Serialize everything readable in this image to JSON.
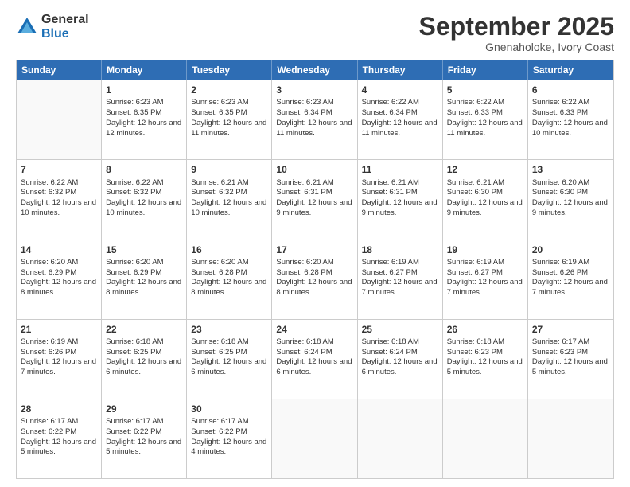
{
  "logo": {
    "general": "General",
    "blue": "Blue"
  },
  "header": {
    "month": "September 2025",
    "location": "Gnenaholoke, Ivory Coast"
  },
  "days": [
    "Sunday",
    "Monday",
    "Tuesday",
    "Wednesday",
    "Thursday",
    "Friday",
    "Saturday"
  ],
  "rows": [
    [
      {
        "day": "",
        "empty": true
      },
      {
        "day": "1",
        "sunrise": "Sunrise: 6:23 AM",
        "sunset": "Sunset: 6:35 PM",
        "daylight": "Daylight: 12 hours and 12 minutes."
      },
      {
        "day": "2",
        "sunrise": "Sunrise: 6:23 AM",
        "sunset": "Sunset: 6:35 PM",
        "daylight": "Daylight: 12 hours and 11 minutes."
      },
      {
        "day": "3",
        "sunrise": "Sunrise: 6:23 AM",
        "sunset": "Sunset: 6:34 PM",
        "daylight": "Daylight: 12 hours and 11 minutes."
      },
      {
        "day": "4",
        "sunrise": "Sunrise: 6:22 AM",
        "sunset": "Sunset: 6:34 PM",
        "daylight": "Daylight: 12 hours and 11 minutes."
      },
      {
        "day": "5",
        "sunrise": "Sunrise: 6:22 AM",
        "sunset": "Sunset: 6:33 PM",
        "daylight": "Daylight: 12 hours and 11 minutes."
      },
      {
        "day": "6",
        "sunrise": "Sunrise: 6:22 AM",
        "sunset": "Sunset: 6:33 PM",
        "daylight": "Daylight: 12 hours and 10 minutes."
      }
    ],
    [
      {
        "day": "7",
        "sunrise": "Sunrise: 6:22 AM",
        "sunset": "Sunset: 6:32 PM",
        "daylight": "Daylight: 12 hours and 10 minutes."
      },
      {
        "day": "8",
        "sunrise": "Sunrise: 6:22 AM",
        "sunset": "Sunset: 6:32 PM",
        "daylight": "Daylight: 12 hours and 10 minutes."
      },
      {
        "day": "9",
        "sunrise": "Sunrise: 6:21 AM",
        "sunset": "Sunset: 6:32 PM",
        "daylight": "Daylight: 12 hours and 10 minutes."
      },
      {
        "day": "10",
        "sunrise": "Sunrise: 6:21 AM",
        "sunset": "Sunset: 6:31 PM",
        "daylight": "Daylight: 12 hours and 9 minutes."
      },
      {
        "day": "11",
        "sunrise": "Sunrise: 6:21 AM",
        "sunset": "Sunset: 6:31 PM",
        "daylight": "Daylight: 12 hours and 9 minutes."
      },
      {
        "day": "12",
        "sunrise": "Sunrise: 6:21 AM",
        "sunset": "Sunset: 6:30 PM",
        "daylight": "Daylight: 12 hours and 9 minutes."
      },
      {
        "day": "13",
        "sunrise": "Sunrise: 6:20 AM",
        "sunset": "Sunset: 6:30 PM",
        "daylight": "Daylight: 12 hours and 9 minutes."
      }
    ],
    [
      {
        "day": "14",
        "sunrise": "Sunrise: 6:20 AM",
        "sunset": "Sunset: 6:29 PM",
        "daylight": "Daylight: 12 hours and 8 minutes."
      },
      {
        "day": "15",
        "sunrise": "Sunrise: 6:20 AM",
        "sunset": "Sunset: 6:29 PM",
        "daylight": "Daylight: 12 hours and 8 minutes."
      },
      {
        "day": "16",
        "sunrise": "Sunrise: 6:20 AM",
        "sunset": "Sunset: 6:28 PM",
        "daylight": "Daylight: 12 hours and 8 minutes."
      },
      {
        "day": "17",
        "sunrise": "Sunrise: 6:20 AM",
        "sunset": "Sunset: 6:28 PM",
        "daylight": "Daylight: 12 hours and 8 minutes."
      },
      {
        "day": "18",
        "sunrise": "Sunrise: 6:19 AM",
        "sunset": "Sunset: 6:27 PM",
        "daylight": "Daylight: 12 hours and 7 minutes."
      },
      {
        "day": "19",
        "sunrise": "Sunrise: 6:19 AM",
        "sunset": "Sunset: 6:27 PM",
        "daylight": "Daylight: 12 hours and 7 minutes."
      },
      {
        "day": "20",
        "sunrise": "Sunrise: 6:19 AM",
        "sunset": "Sunset: 6:26 PM",
        "daylight": "Daylight: 12 hours and 7 minutes."
      }
    ],
    [
      {
        "day": "21",
        "sunrise": "Sunrise: 6:19 AM",
        "sunset": "Sunset: 6:26 PM",
        "daylight": "Daylight: 12 hours and 7 minutes."
      },
      {
        "day": "22",
        "sunrise": "Sunrise: 6:18 AM",
        "sunset": "Sunset: 6:25 PM",
        "daylight": "Daylight: 12 hours and 6 minutes."
      },
      {
        "day": "23",
        "sunrise": "Sunrise: 6:18 AM",
        "sunset": "Sunset: 6:25 PM",
        "daylight": "Daylight: 12 hours and 6 minutes."
      },
      {
        "day": "24",
        "sunrise": "Sunrise: 6:18 AM",
        "sunset": "Sunset: 6:24 PM",
        "daylight": "Daylight: 12 hours and 6 minutes."
      },
      {
        "day": "25",
        "sunrise": "Sunrise: 6:18 AM",
        "sunset": "Sunset: 6:24 PM",
        "daylight": "Daylight: 12 hours and 6 minutes."
      },
      {
        "day": "26",
        "sunrise": "Sunrise: 6:18 AM",
        "sunset": "Sunset: 6:23 PM",
        "daylight": "Daylight: 12 hours and 5 minutes."
      },
      {
        "day": "27",
        "sunrise": "Sunrise: 6:17 AM",
        "sunset": "Sunset: 6:23 PM",
        "daylight": "Daylight: 12 hours and 5 minutes."
      }
    ],
    [
      {
        "day": "28",
        "sunrise": "Sunrise: 6:17 AM",
        "sunset": "Sunset: 6:22 PM",
        "daylight": "Daylight: 12 hours and 5 minutes."
      },
      {
        "day": "29",
        "sunrise": "Sunrise: 6:17 AM",
        "sunset": "Sunset: 6:22 PM",
        "daylight": "Daylight: 12 hours and 5 minutes."
      },
      {
        "day": "30",
        "sunrise": "Sunrise: 6:17 AM",
        "sunset": "Sunset: 6:22 PM",
        "daylight": "Daylight: 12 hours and 4 minutes."
      },
      {
        "day": "",
        "empty": true
      },
      {
        "day": "",
        "empty": true
      },
      {
        "day": "",
        "empty": true
      },
      {
        "day": "",
        "empty": true
      }
    ]
  ]
}
